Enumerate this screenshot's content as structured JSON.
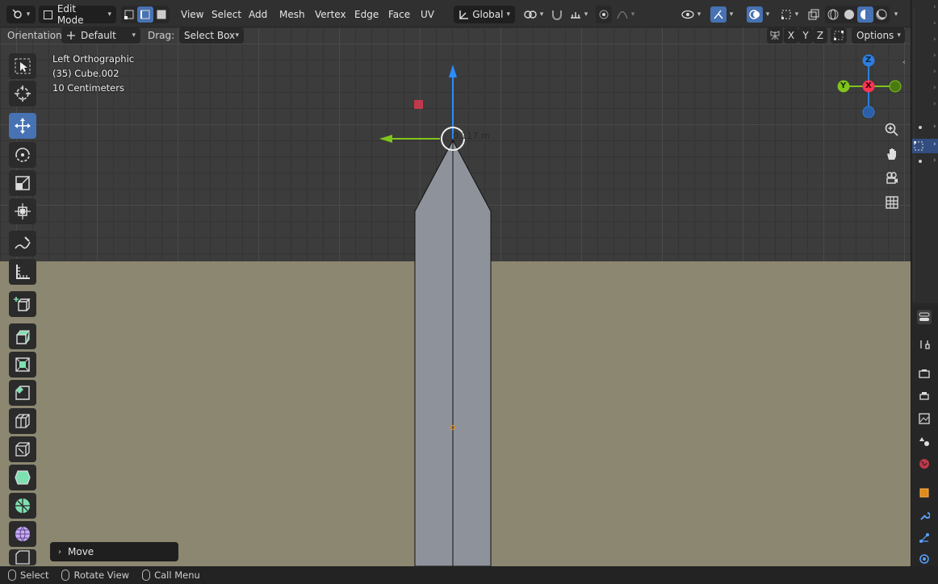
{
  "header": {
    "mode": "Edit Mode",
    "menus": [
      "View",
      "Select",
      "Add",
      "Mesh",
      "Vertex",
      "Edge",
      "Face",
      "UV"
    ],
    "transform_orientation": "Global"
  },
  "tool_settings": {
    "orientation_label": "Orientation:",
    "orientation_value": "Default",
    "drag_label": "Drag:",
    "drag_value": "Select Box",
    "axes": [
      "X",
      "Y",
      "Z"
    ],
    "options_label": "Options"
  },
  "viewport": {
    "view_name": "Left Orthographic",
    "object_name": "(35) Cube.002",
    "scale": "10 Centimeters",
    "distance_readout": "0.117 m"
  },
  "gizmo": {
    "z": "Z",
    "y": "Y",
    "x": "X"
  },
  "last_operator": "Move",
  "status_bar": {
    "select": "Select",
    "rotate_view": "Rotate View",
    "call_menu": "Call Menu"
  },
  "colors": {
    "active_blue": "#4772b3",
    "axis_x": "#ff3352",
    "axis_y": "#8bdc00",
    "axis_z": "#2890ff",
    "ground": "#8c8771",
    "mesh_face": "#8e939b"
  }
}
